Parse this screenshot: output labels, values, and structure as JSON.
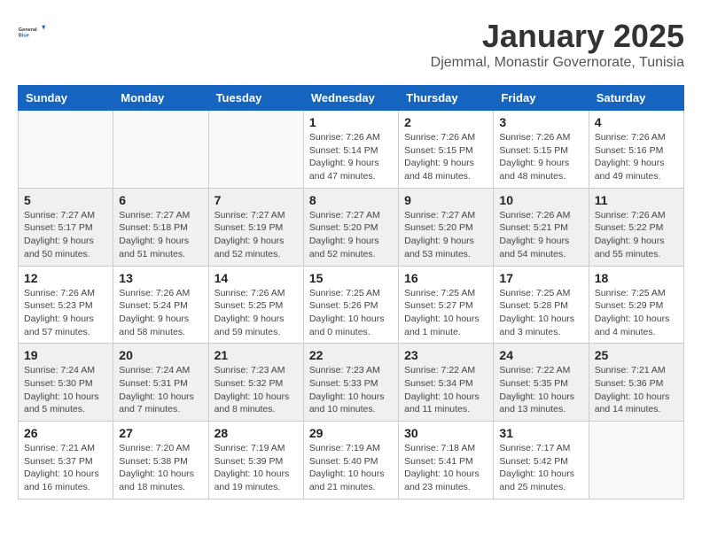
{
  "header": {
    "logo_general": "General",
    "logo_blue": "Blue",
    "main_title": "January 2025",
    "subtitle": "Djemmal, Monastir Governorate, Tunisia"
  },
  "calendar": {
    "columns": [
      "Sunday",
      "Monday",
      "Tuesday",
      "Wednesday",
      "Thursday",
      "Friday",
      "Saturday"
    ],
    "rows": [
      {
        "shaded": false,
        "cells": [
          {
            "day": "",
            "info": ""
          },
          {
            "day": "",
            "info": ""
          },
          {
            "day": "",
            "info": ""
          },
          {
            "day": "1",
            "info": "Sunrise: 7:26 AM\nSunset: 5:14 PM\nDaylight: 9 hours\nand 47 minutes."
          },
          {
            "day": "2",
            "info": "Sunrise: 7:26 AM\nSunset: 5:15 PM\nDaylight: 9 hours\nand 48 minutes."
          },
          {
            "day": "3",
            "info": "Sunrise: 7:26 AM\nSunset: 5:15 PM\nDaylight: 9 hours\nand 48 minutes."
          },
          {
            "day": "4",
            "info": "Sunrise: 7:26 AM\nSunset: 5:16 PM\nDaylight: 9 hours\nand 49 minutes."
          }
        ]
      },
      {
        "shaded": true,
        "cells": [
          {
            "day": "5",
            "info": "Sunrise: 7:27 AM\nSunset: 5:17 PM\nDaylight: 9 hours\nand 50 minutes."
          },
          {
            "day": "6",
            "info": "Sunrise: 7:27 AM\nSunset: 5:18 PM\nDaylight: 9 hours\nand 51 minutes."
          },
          {
            "day": "7",
            "info": "Sunrise: 7:27 AM\nSunset: 5:19 PM\nDaylight: 9 hours\nand 52 minutes."
          },
          {
            "day": "8",
            "info": "Sunrise: 7:27 AM\nSunset: 5:20 PM\nDaylight: 9 hours\nand 52 minutes."
          },
          {
            "day": "9",
            "info": "Sunrise: 7:27 AM\nSunset: 5:20 PM\nDaylight: 9 hours\nand 53 minutes."
          },
          {
            "day": "10",
            "info": "Sunrise: 7:26 AM\nSunset: 5:21 PM\nDaylight: 9 hours\nand 54 minutes."
          },
          {
            "day": "11",
            "info": "Sunrise: 7:26 AM\nSunset: 5:22 PM\nDaylight: 9 hours\nand 55 minutes."
          }
        ]
      },
      {
        "shaded": false,
        "cells": [
          {
            "day": "12",
            "info": "Sunrise: 7:26 AM\nSunset: 5:23 PM\nDaylight: 9 hours\nand 57 minutes."
          },
          {
            "day": "13",
            "info": "Sunrise: 7:26 AM\nSunset: 5:24 PM\nDaylight: 9 hours\nand 58 minutes."
          },
          {
            "day": "14",
            "info": "Sunrise: 7:26 AM\nSunset: 5:25 PM\nDaylight: 9 hours\nand 59 minutes."
          },
          {
            "day": "15",
            "info": "Sunrise: 7:25 AM\nSunset: 5:26 PM\nDaylight: 10 hours\nand 0 minutes."
          },
          {
            "day": "16",
            "info": "Sunrise: 7:25 AM\nSunset: 5:27 PM\nDaylight: 10 hours\nand 1 minute."
          },
          {
            "day": "17",
            "info": "Sunrise: 7:25 AM\nSunset: 5:28 PM\nDaylight: 10 hours\nand 3 minutes."
          },
          {
            "day": "18",
            "info": "Sunrise: 7:25 AM\nSunset: 5:29 PM\nDaylight: 10 hours\nand 4 minutes."
          }
        ]
      },
      {
        "shaded": true,
        "cells": [
          {
            "day": "19",
            "info": "Sunrise: 7:24 AM\nSunset: 5:30 PM\nDaylight: 10 hours\nand 5 minutes."
          },
          {
            "day": "20",
            "info": "Sunrise: 7:24 AM\nSunset: 5:31 PM\nDaylight: 10 hours\nand 7 minutes."
          },
          {
            "day": "21",
            "info": "Sunrise: 7:23 AM\nSunset: 5:32 PM\nDaylight: 10 hours\nand 8 minutes."
          },
          {
            "day": "22",
            "info": "Sunrise: 7:23 AM\nSunset: 5:33 PM\nDaylight: 10 hours\nand 10 minutes."
          },
          {
            "day": "23",
            "info": "Sunrise: 7:22 AM\nSunset: 5:34 PM\nDaylight: 10 hours\nand 11 minutes."
          },
          {
            "day": "24",
            "info": "Sunrise: 7:22 AM\nSunset: 5:35 PM\nDaylight: 10 hours\nand 13 minutes."
          },
          {
            "day": "25",
            "info": "Sunrise: 7:21 AM\nSunset: 5:36 PM\nDaylight: 10 hours\nand 14 minutes."
          }
        ]
      },
      {
        "shaded": false,
        "cells": [
          {
            "day": "26",
            "info": "Sunrise: 7:21 AM\nSunset: 5:37 PM\nDaylight: 10 hours\nand 16 minutes."
          },
          {
            "day": "27",
            "info": "Sunrise: 7:20 AM\nSunset: 5:38 PM\nDaylight: 10 hours\nand 18 minutes."
          },
          {
            "day": "28",
            "info": "Sunrise: 7:19 AM\nSunset: 5:39 PM\nDaylight: 10 hours\nand 19 minutes."
          },
          {
            "day": "29",
            "info": "Sunrise: 7:19 AM\nSunset: 5:40 PM\nDaylight: 10 hours\nand 21 minutes."
          },
          {
            "day": "30",
            "info": "Sunrise: 7:18 AM\nSunset: 5:41 PM\nDaylight: 10 hours\nand 23 minutes."
          },
          {
            "day": "31",
            "info": "Sunrise: 7:17 AM\nSunset: 5:42 PM\nDaylight: 10 hours\nand 25 minutes."
          },
          {
            "day": "",
            "info": ""
          }
        ]
      }
    ]
  }
}
